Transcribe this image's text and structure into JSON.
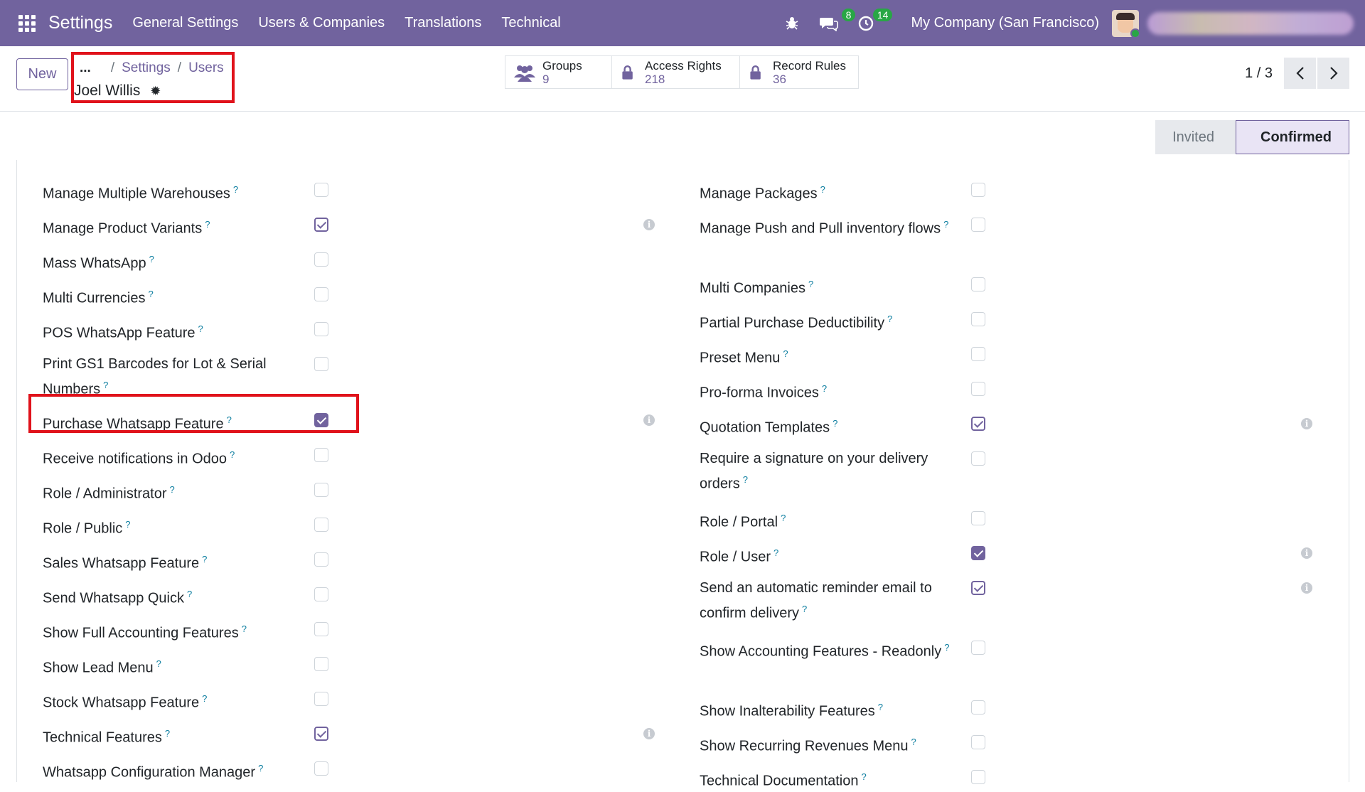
{
  "navbar": {
    "brand": "Settings",
    "menu": [
      "General Settings",
      "Users & Companies",
      "Translations",
      "Technical"
    ],
    "messages_count": "8",
    "activities_count": "14",
    "company": "My Company (San Francisco)"
  },
  "control": {
    "new_label": "New",
    "breadcrumb_more": "...",
    "breadcrumb": [
      "Settings",
      "Users"
    ],
    "record_name": "Joel Willis",
    "smart_buttons": [
      {
        "label": "Groups",
        "value": "9"
      },
      {
        "label": "Access Rights",
        "value": "218"
      },
      {
        "label": "Record Rules",
        "value": "36"
      }
    ],
    "pager": "1 / 3"
  },
  "status": {
    "invited": "Invited",
    "confirmed": "Confirmed"
  },
  "left_fields": [
    {
      "label": "Manage Multiple Warehouses",
      "checked": false
    },
    {
      "label": "Manage Product Variants",
      "checked": true
    },
    {
      "label": "Mass WhatsApp",
      "checked": false
    },
    {
      "label": "Multi Currencies",
      "checked": false
    },
    {
      "label": "POS WhatsApp Feature",
      "checked": false
    },
    {
      "label": "Print GS1 Barcodes for Lot & Serial Numbers",
      "checked": false
    },
    {
      "label": "Purchase Whatsapp Feature",
      "checked": true
    },
    {
      "label": "Receive notifications in Odoo",
      "checked": false
    },
    {
      "label": "Role / Administrator",
      "checked": false
    },
    {
      "label": "Role / Public",
      "checked": false
    },
    {
      "label": "Sales Whatsapp Feature",
      "checked": false
    },
    {
      "label": "Send Whatsapp Quick",
      "checked": false
    },
    {
      "label": "Show Full Accounting Features",
      "checked": false
    },
    {
      "label": "Show Lead Menu",
      "checked": false
    },
    {
      "label": "Stock Whatsapp Feature",
      "checked": false
    },
    {
      "label": "Technical Features",
      "checked": true
    },
    {
      "label": "Whatsapp Configuration Manager",
      "checked": false
    }
  ],
  "right_fields": [
    {
      "label": "Manage Packages",
      "checked": false
    },
    {
      "label": "Manage Push and Pull inventory flows",
      "checked": false
    },
    {
      "label": "Multi Companies",
      "checked": false
    },
    {
      "label": "Partial Purchase Deductibility",
      "checked": false
    },
    {
      "label": "Preset Menu",
      "checked": false
    },
    {
      "label": "Pro-forma Invoices",
      "checked": false
    },
    {
      "label": "Quotation Templates",
      "checked": true
    },
    {
      "label": "Require a signature on your delivery orders",
      "checked": false
    },
    {
      "label": "Role / Portal",
      "checked": false
    },
    {
      "label": "Role / User",
      "checked": true
    },
    {
      "label": "Send an automatic reminder email to confirm delivery",
      "checked": true
    },
    {
      "label": "Show Accounting Features - Readonly",
      "checked": false
    },
    {
      "label": "Show Inalterability Features",
      "checked": false
    },
    {
      "label": "Show Recurring Revenues Menu",
      "checked": false
    },
    {
      "label": "Technical Documentation",
      "checked": false
    }
  ],
  "help_mark": "?",
  "info_mark": "i"
}
